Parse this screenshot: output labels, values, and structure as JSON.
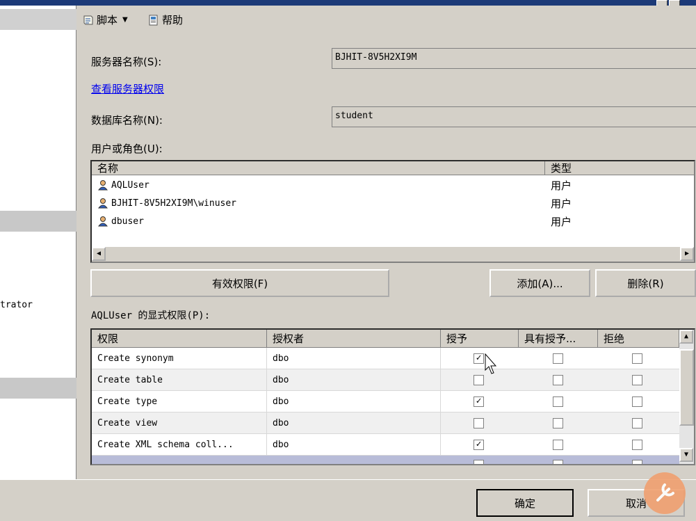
{
  "toolbar": {
    "script_label": "脚本",
    "help_label": "帮助"
  },
  "form": {
    "server_label": "服务器名称(S):",
    "server_value": "BJHIT-8V5H2XI9M",
    "view_server_perms": "查看服务器权限",
    "db_label": "数据库名称(N):",
    "db_value": "student",
    "users_label": "用户或角色(U):"
  },
  "users": {
    "headers": [
      "名称",
      "类型"
    ],
    "rows": [
      {
        "name": "AQLUser",
        "type": "用户"
      },
      {
        "name": "BJHIT-8V5H2XI9M\\winuser",
        "type": "用户"
      },
      {
        "name": "dbuser",
        "type": "用户"
      }
    ]
  },
  "buttons": {
    "effective": "有效权限(F)",
    "add": "添加(A)...",
    "remove": "删除(R)",
    "ok": "确定",
    "cancel": "取消"
  },
  "perms": {
    "title": "AQLUser 的显式权限(P):",
    "headers": [
      "权限",
      "授权者",
      "授予",
      "具有授予...",
      "拒绝"
    ],
    "rows": [
      {
        "name": "Create synonym",
        "grantor": "dbo",
        "grant": true,
        "with_grant": false,
        "deny": false
      },
      {
        "name": "Create table",
        "grantor": "dbo",
        "grant": false,
        "with_grant": false,
        "deny": false
      },
      {
        "name": "Create type",
        "grantor": "dbo",
        "grant": true,
        "with_grant": false,
        "deny": false
      },
      {
        "name": "Create view",
        "grantor": "dbo",
        "grant": false,
        "with_grant": false,
        "deny": false
      },
      {
        "name": "Create XML schema coll...",
        "grantor": "dbo",
        "grant": true,
        "with_grant": false,
        "deny": false
      }
    ]
  },
  "left": {
    "text": "trator"
  }
}
